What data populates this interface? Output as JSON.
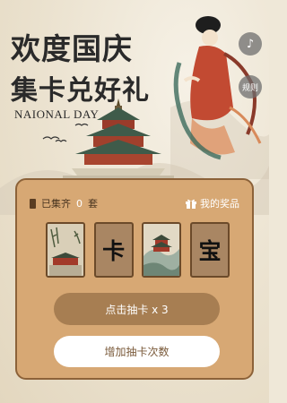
{
  "header": {
    "title_line1": "欢度国庆",
    "title_line2": "集卡兑好礼",
    "subtitle": "NAIONAL DAY"
  },
  "side": {
    "music_icon": "music-note-icon",
    "rules_label": "规则"
  },
  "panel": {
    "collected_prefix": "已集齐",
    "collected_count": "0",
    "collected_suffix": "套",
    "prize_label": "我的奖品",
    "cards": [
      {
        "type": "image",
        "name": "palace-bamboo-card"
      },
      {
        "type": "text",
        "char": "卡"
      },
      {
        "type": "image",
        "name": "temple-mountain-card"
      },
      {
        "type": "text",
        "char": "宝"
      }
    ],
    "draw_button": "点击抽卡 x 3",
    "add_button": "增加抽卡次数"
  },
  "colors": {
    "background": "#efe8d8",
    "panel": "#d7a874",
    "panel_border": "#8c6239",
    "draw_button": "#a77e52",
    "add_button": "#ffffff"
  }
}
